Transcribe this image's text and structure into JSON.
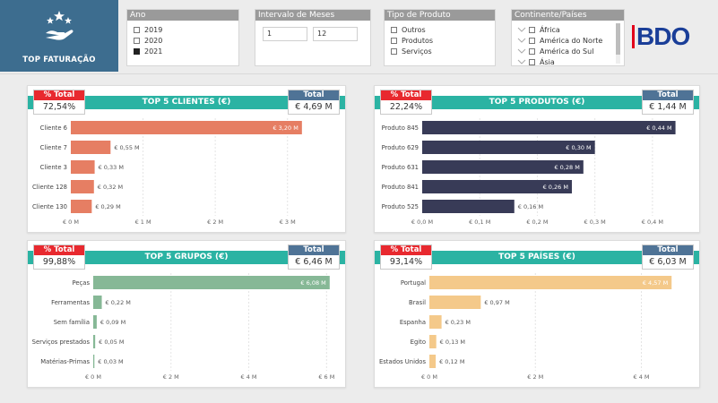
{
  "brand": {
    "title": "TOP FATURAÇÃO"
  },
  "filters": {
    "ano": {
      "title": "Ano",
      "options": [
        {
          "label": "2019",
          "checked": false
        },
        {
          "label": "2020",
          "checked": false
        },
        {
          "label": "2021",
          "checked": true
        }
      ]
    },
    "meses": {
      "title": "Intervalo de Meses",
      "from": "1",
      "to": "12"
    },
    "produto": {
      "title": "Tipo de Produto",
      "options": [
        {
          "label": "Outros",
          "checked": false
        },
        {
          "label": "Produtos",
          "checked": false
        },
        {
          "label": "Serviços",
          "checked": false
        }
      ]
    },
    "continente": {
      "title": "Continente/Países",
      "options": [
        {
          "label": "África",
          "checked": false
        },
        {
          "label": "América do Norte",
          "checked": false
        },
        {
          "label": "América do Sul",
          "checked": false
        },
        {
          "label": "Ásia",
          "checked": false
        }
      ]
    }
  },
  "logo": {
    "text": "BDO"
  },
  "colors": {
    "teal": "#2bb3a3",
    "red": "#e8292f",
    "blue": "#4f7396"
  },
  "cards": {
    "clientes": {
      "title": "TOP 5 CLIENTES (€)",
      "pct_label": "% Total",
      "pct": "72,54%",
      "total_label": "Total",
      "total": "€ 4,69 M"
    },
    "produtos": {
      "title": "TOP 5 PRODUTOS (€)",
      "pct_label": "% Total",
      "pct": "22,24%",
      "total_label": "Total",
      "total": "€ 1,44 M"
    },
    "grupos": {
      "title": "TOP 5 GRUPOS (€)",
      "pct_label": "% Total",
      "pct": "99,88%",
      "total_label": "Total",
      "total": "€ 6,46 M"
    },
    "paises": {
      "title": "TOP 5 PAÍSES (€)",
      "pct_label": "% Total",
      "pct": "93,14%",
      "total_label": "Total",
      "total": "€ 6,03 M"
    }
  },
  "chart_data": [
    {
      "id": "clientes",
      "type": "bar",
      "orientation": "horizontal",
      "color": "#e67e63",
      "categories": [
        "Cliente 6",
        "Cliente 7",
        "Cliente 3",
        "Cliente 128",
        "Cliente 130"
      ],
      "values": [
        3.2,
        0.55,
        0.33,
        0.32,
        0.29
      ],
      "labels": [
        "€ 3,20 M",
        "€ 0,55 M",
        "€ 0,33 M",
        "€ 0,32 M",
        "€ 0,29 M"
      ],
      "xlim": [
        0,
        3.5
      ],
      "ticks": [
        0,
        1,
        2,
        3
      ],
      "tick_labels": [
        "€ 0 M",
        "€ 1 M",
        "€ 2 M",
        "€ 3 M"
      ]
    },
    {
      "id": "produtos",
      "type": "bar",
      "orientation": "horizontal",
      "color": "#383b57",
      "categories": [
        "Produto 845",
        "Produto 629",
        "Produto 631",
        "Produto 841",
        "Produto 525"
      ],
      "values": [
        0.44,
        0.3,
        0.28,
        0.26,
        0.16
      ],
      "labels": [
        "€ 0,44 M",
        "€ 0,30 M",
        "€ 0,28 M",
        "€ 0,26 M",
        "€ 0,16 M"
      ],
      "xlim": [
        0,
        0.45
      ],
      "ticks": [
        0,
        0.1,
        0.2,
        0.3,
        0.4
      ],
      "tick_labels": [
        "€ 0,0 M",
        "€ 0,1 M",
        "€ 0,2 M",
        "€ 0,3 M",
        "€ 0,4 M"
      ]
    },
    {
      "id": "grupos",
      "type": "bar",
      "orientation": "horizontal",
      "color": "#86b896",
      "categories": [
        "Peças",
        "Ferramentas",
        "Sem família",
        "Serviços prestados",
        "Matérias-Primas"
      ],
      "values": [
        6.08,
        0.22,
        0.09,
        0.05,
        0.03
      ],
      "labels": [
        "€ 6,08 M",
        "€ 0,22 M",
        "€ 0,09 M",
        "€ 0,05 M",
        "€ 0,03 M"
      ],
      "xlim": [
        0,
        6.2
      ],
      "ticks": [
        0,
        2,
        4,
        6
      ],
      "tick_labels": [
        "€ 0 M",
        "€ 2 M",
        "€ 4 M",
        "€ 6 M"
      ]
    },
    {
      "id": "paises",
      "type": "bar",
      "orientation": "horizontal",
      "color": "#f4c98a",
      "categories": [
        "Portugal",
        "Brasil",
        "Espanha",
        "Egito",
        "Estados Unidos"
      ],
      "values": [
        4.57,
        0.97,
        0.23,
        0.13,
        0.12
      ],
      "labels": [
        "€ 4,57 M",
        "€ 0,97 M",
        "€ 0,23 M",
        "€ 0,13 M",
        "€ 0,12 M"
      ],
      "xlim": [
        0,
        4.6
      ],
      "ticks": [
        0,
        2,
        4
      ],
      "tick_labels": [
        "€ 0 M",
        "€ 2 M",
        "€ 4 M"
      ]
    }
  ]
}
